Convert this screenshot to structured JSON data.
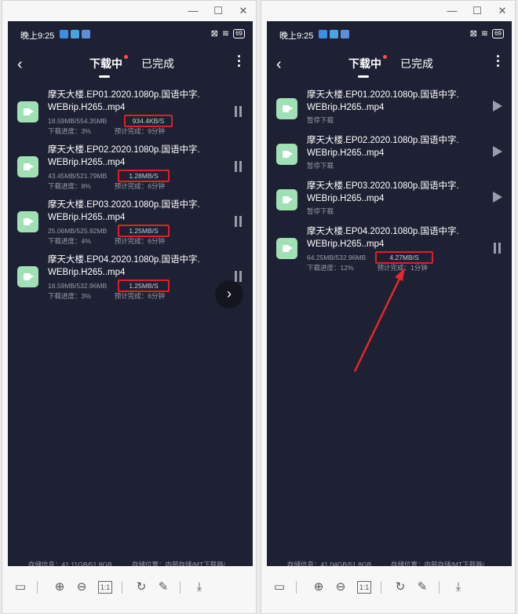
{
  "window": {
    "minimize": "—",
    "maximize": "☐",
    "close": "✕"
  },
  "status": {
    "time": "晚上9:25",
    "battery": "69"
  },
  "nav": {
    "back": "‹",
    "tab_downloading": "下载中",
    "tab_done": "已完成",
    "more": "⋮"
  },
  "left": {
    "items": [
      {
        "name": "摩天大楼.EP01.2020.1080p.国语中字.WEBrip.H265..mp4",
        "size": "18.59MB/554.35MB",
        "speed": "934.4KB/S",
        "progress": "下载进度：3%",
        "eta": "预计完成：9分钟"
      },
      {
        "name": "摩天大楼.EP02.2020.1080p.国语中字.WEBrip.H265..mp4",
        "size": "43.45MB/521.79MB",
        "speed": "1.28MB/S",
        "progress": "下载进度：8%",
        "eta": "预计完成：6分钟"
      },
      {
        "name": "摩天大楼.EP03.2020.1080p.国语中字.WEBrip.H265..mp4",
        "size": "25.06MB/525.92MB",
        "speed": "1.25MB/S",
        "progress": "下载进度：4%",
        "eta": "预计完成：6分钟"
      },
      {
        "name": "摩天大楼.EP04.2020.1080p.国语中字.WEBrip.H265..mp4",
        "size": "18.59MB/532.96MB",
        "speed": "1.25MB/S",
        "progress": "下载进度：3%",
        "eta": "预计完成：6分钟"
      }
    ],
    "fab": "›",
    "storage_info": "存储信息：41.11GB/51.8GB",
    "storage_location": "存储位置：内部存储/MT下载器/"
  },
  "right": {
    "paused_items": [
      {
        "name": "摩天大楼.EP01.2020.1080p.国语中字.WEBrip.H265..mp4",
        "status": "暂停下载"
      },
      {
        "name": "摩天大楼.EP02.2020.1080p.国语中字.WEBrip.H265..mp4",
        "status": "暂停下载"
      },
      {
        "name": "摩天大楼.EP03.2020.1080p.国语中字.WEBrip.H265..mp4",
        "status": "暂停下载"
      }
    ],
    "active_item": {
      "name": "摩天大楼.EP04.2020.1080p.国语中字.WEBrip.H265..mp4",
      "size": "64.25MB/532.96MB",
      "speed": "4.27MB/S",
      "progress": "下载进度：12%",
      "eta": "预计完成：1分钟"
    },
    "storage_info": "存储信息：41.04GB/51.8GB",
    "storage_location": "存储位置：内部存储/MT下载器/"
  },
  "toolbar": {
    "fit": "▭",
    "zoom_in": "⊕",
    "zoom_out": "⊖",
    "actual": "1:1",
    "rotate": "↻",
    "edit": "✎",
    "download": "⤓"
  },
  "colors": {
    "screen_bg": "#1e2133",
    "highlight_box": "#e01f25",
    "file_icon": "#9fe0b4"
  }
}
